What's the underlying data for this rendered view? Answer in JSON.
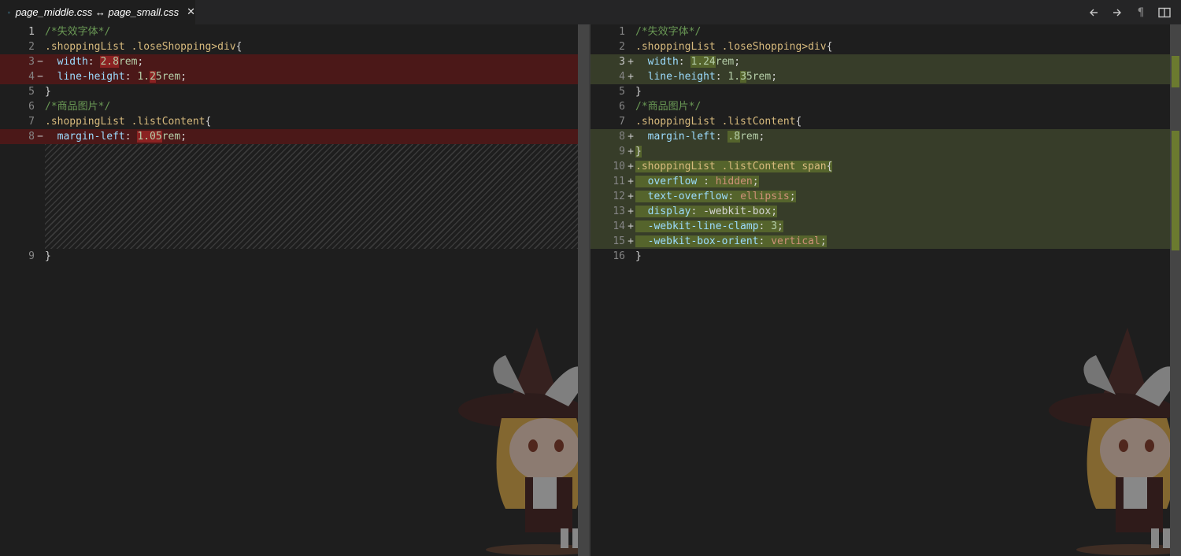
{
  "tab": {
    "icon": "css-file-icon",
    "title": "page_middle.css ↔ page_small.css",
    "close_glyph": "✕"
  },
  "actions": [
    {
      "name": "previous-change-button",
      "icon": "arrow-left-icon"
    },
    {
      "name": "next-change-button",
      "icon": "arrow-right-icon"
    },
    {
      "name": "toggle-whitespace-button",
      "icon": "pilcrow-icon",
      "glyph": "¶"
    },
    {
      "name": "toggle-inline-view-button",
      "icon": "split-editor-icon"
    }
  ],
  "left": {
    "file": "page_middle.css",
    "lines": [
      {
        "n": "1",
        "type": "normal",
        "cur": true,
        "tokens": [
          [
            "c-com",
            "/*失效字体*/"
          ]
        ]
      },
      {
        "n": "2",
        "type": "normal",
        "tokens": [
          [
            "c-sel",
            ".shoppingList .loseShopping>div"
          ],
          [
            "c-p",
            "{"
          ]
        ]
      },
      {
        "n": "3",
        "type": "del",
        "marker": "−",
        "tokens": [
          [
            "c-p",
            "  "
          ],
          [
            "c-prop",
            "width"
          ],
          [
            "c-p",
            ": "
          ],
          [
            "c-num hl-del",
            "2.8"
          ],
          [
            "c-num",
            "rem"
          ],
          [
            "c-p",
            ";"
          ]
        ]
      },
      {
        "n": "4",
        "type": "del",
        "marker": "−",
        "tokens": [
          [
            "c-p",
            "  "
          ],
          [
            "c-prop",
            "line-height"
          ],
          [
            "c-p",
            ": "
          ],
          [
            "c-num",
            "1."
          ],
          [
            "c-num hl-del",
            "2"
          ],
          [
            "c-num",
            "5rem"
          ],
          [
            "c-p",
            ";"
          ]
        ]
      },
      {
        "n": "5",
        "type": "normal",
        "tokens": [
          [
            "c-p",
            "}"
          ]
        ]
      },
      {
        "n": "6",
        "type": "normal",
        "tokens": [
          [
            "c-com",
            "/*商品图片*/"
          ]
        ]
      },
      {
        "n": "7",
        "type": "normal",
        "tokens": [
          [
            "c-sel",
            ".shoppingList .listContent"
          ],
          [
            "c-p",
            "{"
          ]
        ]
      },
      {
        "n": "8",
        "type": "del",
        "marker": "−",
        "tokens": [
          [
            "c-p",
            "  "
          ],
          [
            "c-prop",
            "margin-left"
          ],
          [
            "c-p",
            ": "
          ],
          [
            "c-num hl-del",
            "1.05"
          ],
          [
            "c-num",
            "rem"
          ],
          [
            "c-p",
            ";"
          ]
        ]
      },
      {
        "n": "",
        "type": "filler",
        "tokens": []
      },
      {
        "n": "9",
        "type": "normal",
        "tokens": [
          [
            "c-p",
            "}"
          ]
        ]
      }
    ]
  },
  "right": {
    "file": "page_small.css",
    "lines": [
      {
        "n": "1",
        "type": "normal",
        "tokens": [
          [
            "c-com",
            "/*失效字体*/"
          ]
        ]
      },
      {
        "n": "2",
        "type": "normal",
        "tokens": [
          [
            "c-sel",
            ".shoppingList .loseShopping>div"
          ],
          [
            "c-p",
            "{"
          ]
        ]
      },
      {
        "n": "3",
        "type": "ins",
        "cur": true,
        "marker": "+",
        "tokens": [
          [
            "c-p",
            "  "
          ],
          [
            "c-prop",
            "width"
          ],
          [
            "c-p",
            ": "
          ],
          [
            "c-num hl-ins",
            "1.24"
          ],
          [
            "c-num",
            "rem"
          ],
          [
            "c-p",
            ";"
          ]
        ]
      },
      {
        "n": "4",
        "type": "ins",
        "marker": "+",
        "tokens": [
          [
            "c-p",
            "  "
          ],
          [
            "c-prop",
            "line-height"
          ],
          [
            "c-p",
            ": "
          ],
          [
            "c-num",
            "1."
          ],
          [
            "c-num hl-ins",
            "3"
          ],
          [
            "c-num",
            "5rem"
          ],
          [
            "c-p",
            ";"
          ]
        ]
      },
      {
        "n": "5",
        "type": "normal",
        "tokens": [
          [
            "c-p",
            "}"
          ]
        ]
      },
      {
        "n": "6",
        "type": "normal",
        "tokens": [
          [
            "c-com",
            "/*商品图片*/"
          ]
        ]
      },
      {
        "n": "7",
        "type": "normal",
        "tokens": [
          [
            "c-sel",
            ".shoppingList .listContent"
          ],
          [
            "c-p",
            "{"
          ]
        ]
      },
      {
        "n": "8",
        "type": "ins",
        "marker": "+",
        "tokens": [
          [
            "c-p",
            "  "
          ],
          [
            "c-prop",
            "margin-left"
          ],
          [
            "c-p",
            ": "
          ],
          [
            "c-num hl-ins",
            ".8"
          ],
          [
            "c-num",
            "rem"
          ],
          [
            "c-p",
            ";"
          ]
        ]
      },
      {
        "n": "9",
        "type": "ins",
        "marker": "+",
        "tokens": [
          [
            "c-p hl-ins",
            "}"
          ]
        ]
      },
      {
        "n": "10",
        "type": "ins",
        "marker": "+",
        "tokens": [
          [
            "c-sel hl-ins",
            ".shoppingList .listContent span"
          ],
          [
            "c-p hl-ins",
            "{"
          ]
        ]
      },
      {
        "n": "11",
        "type": "ins",
        "marker": "+",
        "tokens": [
          [
            "c-p hl-ins",
            "  "
          ],
          [
            "c-prop hl-ins",
            "overflow"
          ],
          [
            "c-p hl-ins",
            " : "
          ],
          [
            "c-val hl-ins",
            "hidden"
          ],
          [
            "c-p hl-ins",
            ";"
          ]
        ]
      },
      {
        "n": "12",
        "type": "ins",
        "marker": "+",
        "tokens": [
          [
            "c-p hl-ins",
            "  "
          ],
          [
            "c-prop hl-ins",
            "text-overflow"
          ],
          [
            "c-p hl-ins",
            ": "
          ],
          [
            "c-val hl-ins",
            "ellipsis"
          ],
          [
            "c-p hl-ins",
            ";"
          ]
        ]
      },
      {
        "n": "13",
        "type": "ins",
        "marker": "+",
        "tokens": [
          [
            "c-p hl-ins",
            "  "
          ],
          [
            "c-prop hl-ins",
            "display"
          ],
          [
            "c-p hl-ins",
            ": -webkit-box;"
          ]
        ]
      },
      {
        "n": "14",
        "type": "ins",
        "marker": "+",
        "tokens": [
          [
            "c-p hl-ins",
            "  "
          ],
          [
            "c-prop hl-ins",
            "-webkit-line-clamp"
          ],
          [
            "c-p hl-ins",
            ": "
          ],
          [
            "c-num hl-ins",
            "3"
          ],
          [
            "c-p hl-ins",
            ";"
          ]
        ]
      },
      {
        "n": "15",
        "type": "ins",
        "marker": "+",
        "tokens": [
          [
            "c-p hl-ins",
            "  "
          ],
          [
            "c-prop hl-ins",
            "-webkit-box-orient"
          ],
          [
            "c-p hl-ins",
            ": "
          ],
          [
            "c-val hl-ins",
            "vertical"
          ],
          [
            "c-p hl-ins",
            ";"
          ]
        ]
      },
      {
        "n": "16",
        "type": "normal",
        "tokens": [
          [
            "c-p",
            "}"
          ]
        ]
      }
    ]
  },
  "colors": {
    "editor_bg": "#1e1e1e",
    "removed_line": "#4b1818",
    "inserted_line": "#373d29",
    "comment": "#6a9955",
    "selector": "#d7ba7d",
    "property": "#9cdcfe",
    "number": "#b5cea8",
    "string_value": "#ce9178"
  },
  "background_image": "anime-witch-character-watermark"
}
